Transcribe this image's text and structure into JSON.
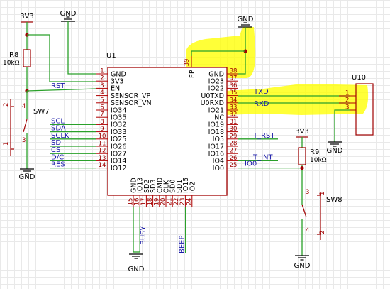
{
  "diagram": {
    "components": {
      "u1": {
        "ref": "U1"
      },
      "u10": {
        "ref": "U10"
      },
      "r8": {
        "ref": "R8",
        "value": "10kΩ"
      },
      "r9": {
        "ref": "R9",
        "value": "10kΩ"
      },
      "sw7": {
        "ref": "SW7"
      },
      "sw8": {
        "ref": "SW8"
      }
    },
    "u1_pins": {
      "left": [
        {
          "num": "1",
          "name": "GND"
        },
        {
          "num": "2",
          "name": "3V3"
        },
        {
          "num": "3",
          "name": "EN"
        },
        {
          "num": "4",
          "name": "SENSOR_VP"
        },
        {
          "num": "5",
          "name": "SENSOR_VN"
        },
        {
          "num": "6",
          "name": "IO34"
        },
        {
          "num": "7",
          "name": "IO35"
        },
        {
          "num": "8",
          "name": "IO32"
        },
        {
          "num": "9",
          "name": "IO33"
        },
        {
          "num": "10",
          "name": "IO25"
        },
        {
          "num": "11",
          "name": "IO26"
        },
        {
          "num": "12",
          "name": "IO27"
        },
        {
          "num": "13",
          "name": "IO14"
        },
        {
          "num": "14",
          "name": "IO12"
        }
      ],
      "right": [
        {
          "num": "38",
          "name": "GND"
        },
        {
          "num": "37",
          "name": "IO23"
        },
        {
          "num": "36",
          "name": "IO22"
        },
        {
          "num": "35",
          "name": "U0TXD"
        },
        {
          "num": "34",
          "name": "U0RXD"
        },
        {
          "num": "33",
          "name": "IO21"
        },
        {
          "num": "32",
          "name": "NC"
        },
        {
          "num": "31",
          "name": "IO19"
        },
        {
          "num": "30",
          "name": "IO18"
        },
        {
          "num": "29",
          "name": "IO5"
        },
        {
          "num": "28",
          "name": "IO17"
        },
        {
          "num": "27",
          "name": "IO16"
        },
        {
          "num": "26",
          "name": "IO4"
        },
        {
          "num": "25",
          "name": "IO0"
        }
      ],
      "bottom": [
        {
          "num": "15",
          "name": "GND"
        },
        {
          "num": "16",
          "name": "IO13"
        },
        {
          "num": "17",
          "name": "SD2"
        },
        {
          "num": "18",
          "name": "SD3"
        },
        {
          "num": "19",
          "name": "CMD"
        },
        {
          "num": "20",
          "name": "CLK"
        },
        {
          "num": "21",
          "name": "SD0"
        },
        {
          "num": "22",
          "name": "SD1"
        },
        {
          "num": "23",
          "name": "IO15"
        },
        {
          "num": "24",
          "name": "IO2"
        }
      ],
      "top": {
        "num": "39",
        "name": "EP"
      }
    },
    "u10_pins": [
      "1",
      "2",
      "3"
    ],
    "sw_pins": {
      "sw7": [
        "2",
        "4",
        "1",
        "3"
      ],
      "sw8": [
        "3",
        "1",
        "4",
        "2"
      ]
    },
    "left_net_labels": [
      "SCL",
      "SDA",
      "SCLK",
      "SDI",
      "CS",
      "D/C",
      "RES"
    ],
    "nets": {
      "rst": "RST",
      "txd": "TXD",
      "rxd": "RXD",
      "t_rst": "T_RST",
      "t_int": "T_INT",
      "io0": "IO0",
      "busy": "BUSY",
      "beep": "BEEP"
    },
    "power": {
      "vcc": "3V3",
      "gnd": "GND"
    },
    "highlight_color": "#ffff00",
    "wire_color": "#2aa02a",
    "symbol_color": "#a00000",
    "net_label_color": "#1a1aa8"
  }
}
